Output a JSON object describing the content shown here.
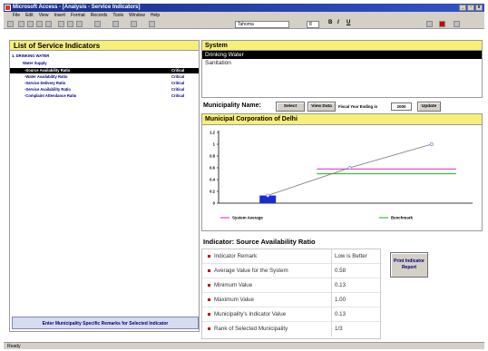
{
  "window": {
    "title": "Microsoft Access - [Analysis - Service Indicators]"
  },
  "menu": [
    "File",
    "Edit",
    "View",
    "Insert",
    "Format",
    "Records",
    "Tools",
    "Window",
    "Help"
  ],
  "toolbar": {
    "font": "Tahoma",
    "size": "8",
    "bold": "B",
    "italic": "I",
    "underline": "U"
  },
  "left_panel": {
    "title": "List of Service Indicators",
    "category": "1. DRINKING WATER",
    "subcategory": "Water Supply",
    "items": [
      {
        "label": "-Source Availability Ratio",
        "status": "Critical"
      },
      {
        "label": "-Water Availability Ratio",
        "status": "Critical"
      },
      {
        "label": "-Service Delivery Ratio",
        "status": "Critical"
      },
      {
        "label": "-Service Availability Ratio",
        "status": "Critical"
      },
      {
        "label": "-Complaint Attendance Ratio",
        "status": "Critical"
      }
    ],
    "remarks_button": "Enter Municipality Specific Remarks for Selected Indicator"
  },
  "system": {
    "title": "System",
    "items": [
      "Drinking Water",
      "Sanitation"
    ]
  },
  "municipality": {
    "label": "Municipality Name:",
    "select_button": "Select",
    "view_data_button": "View Data",
    "fiscal_year_label": "Fiscal Year Ending in",
    "fiscal_year_value": "2000",
    "update_button": "Update",
    "name": "Municipal Corporation of Delhi"
  },
  "chart_data": {
    "type": "line",
    "x": [
      1,
      2,
      3
    ],
    "ylim": [
      0,
      1.2
    ],
    "yticks": [
      "0",
      "0.2",
      "0.4",
      "0.6",
      "0.8",
      "1",
      "1.2"
    ],
    "series": [
      {
        "name": "System Average",
        "values": [
          0.58,
          0.58,
          0.58
        ],
        "color": "#e03ad9"
      },
      {
        "name": "Benchmark",
        "values": [
          0.5,
          0.5,
          0.5
        ],
        "color": "#33c233"
      }
    ],
    "bar": {
      "value": 0.13,
      "color": "#1a2bd6"
    },
    "line_points": [
      [
        1,
        0.13
      ],
      [
        2,
        0.6
      ],
      [
        3,
        1.0
      ]
    ],
    "line_color": "#777777",
    "marker_color": "#8080e0",
    "legend_placement": "bottom"
  },
  "indicator": {
    "heading": "Indicator:  Source Availability Ratio",
    "rows": [
      {
        "label": "Indicator Remark",
        "value": "Low is Better"
      },
      {
        "label": "Average Value for the System",
        "value": "0.58"
      },
      {
        "label": "Minimum Value",
        "value": "0.13"
      },
      {
        "label": "Maximum Value",
        "value": "1.00"
      },
      {
        "label": "Municipality's Indicator Value",
        "value": "0.13"
      },
      {
        "label": "Rank of Selected Municipality",
        "value": "1/3"
      }
    ],
    "print_button": "Print Indicator Report"
  },
  "status": {
    "text": "Ready"
  }
}
